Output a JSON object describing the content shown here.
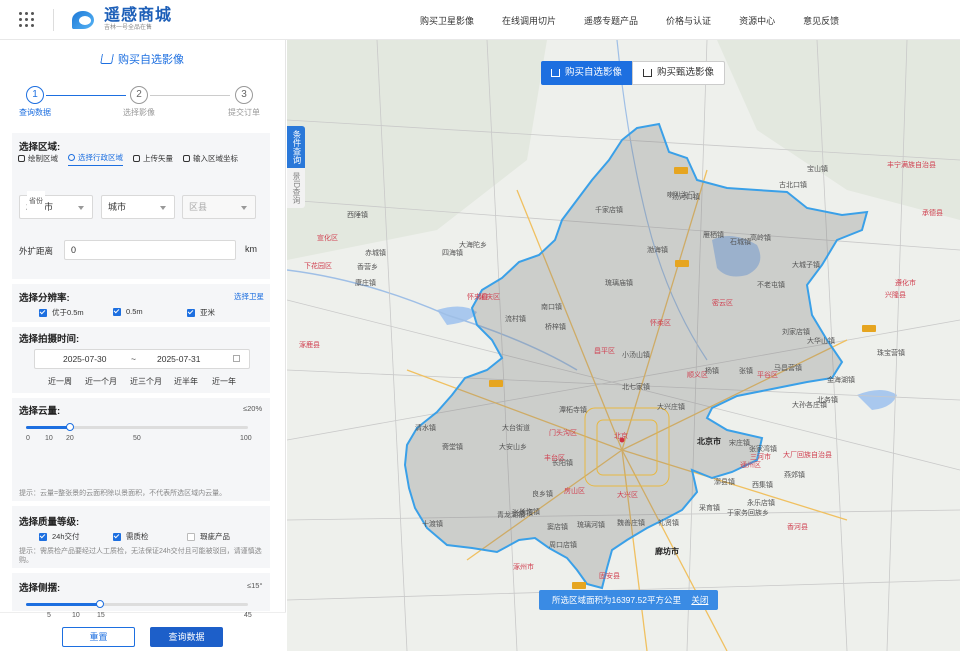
{
  "header": {
    "logo_title": "遥感商城",
    "logo_subtitle": "吉林一号全品在售",
    "nav": [
      "购买卫星影像",
      "在线调用切片",
      "遥感专题产品",
      "价格与认证",
      "资源中心",
      "意见反馈"
    ]
  },
  "sidebar": {
    "title": "购买自选影像",
    "steps": [
      {
        "num": "1",
        "label": "查询数据"
      },
      {
        "num": "2",
        "label": "选择影像"
      },
      {
        "num": "3",
        "label": "提交订单"
      }
    ],
    "region": {
      "title": "选择区域:",
      "tabs": [
        "绘制区域",
        "选择行政区域",
        "上传矢量",
        "输入区域坐标"
      ],
      "province_legend": "省份",
      "province": "北京市",
      "city": "城市",
      "district": "区县",
      "buffer_label": "外扩距离",
      "buffer_value": "0",
      "buffer_unit": "km"
    },
    "resolution": {
      "title": "选择分辨率:",
      "link": "选择卫星",
      "options": [
        {
          "label": "优于0.5m",
          "checked": true
        },
        {
          "label": "0.5m",
          "checked": true
        },
        {
          "label": "亚米",
          "checked": true
        }
      ]
    },
    "time": {
      "title": "选择拍摄时间:",
      "start": "2025-07-30",
      "sep": "~",
      "end": "2025-07-31",
      "quick": [
        "近一周",
        "近一个月",
        "近三个月",
        "近半年",
        "近一年"
      ]
    },
    "cloud": {
      "title": "选择云量:",
      "value_label": "≤20%",
      "value": 20,
      "max": 100,
      "ticks": [
        "0",
        "10",
        "20",
        "50",
        "100"
      ],
      "hint": "提示：云量=整张景的云面积除以景面积，不代表所选区域内云量。"
    },
    "quality": {
      "title": "选择质量等级:",
      "options": [
        {
          "label": "24h交付",
          "checked": true
        },
        {
          "label": "需质检",
          "checked": true
        },
        {
          "label": "瑕疵产品",
          "checked": false
        }
      ],
      "hint": "提示：需质检产品要经过人工质检，无法保证24h交付且可能被驳回，请谨慎选购。"
    },
    "tilt": {
      "title": "选择侧摆:",
      "value_label": "≤15°",
      "value": 15,
      "max": 45,
      "ticks": [
        "0",
        "5",
        "10",
        "15",
        "45"
      ]
    },
    "buttons": {
      "reset": "重置",
      "query": "查询数据"
    }
  },
  "map": {
    "side_tab_primary": "条件查询",
    "side_tab_secondary": "景ID查询",
    "toggle_active": "购买自选影像",
    "toggle_inactive": "购买甄选影像",
    "area_text": "所选区域面积为16397.52平方公里",
    "area_close": "关闭",
    "labels": [
      {
        "t": "北京",
        "c": "dist"
      },
      {
        "t": "北京市",
        "c": "big"
      },
      {
        "t": "廊坊市",
        "c": "big"
      },
      {
        "t": "门头沟区",
        "c": "dist"
      },
      {
        "t": "丰台区",
        "c": "dist"
      },
      {
        "t": "房山区",
        "c": "dist"
      },
      {
        "t": "大兴区",
        "c": "dist"
      },
      {
        "t": "昌平区",
        "c": "dist"
      },
      {
        "t": "怀柔区",
        "c": "dist"
      },
      {
        "t": "密云区",
        "c": "dist"
      },
      {
        "t": "顺义区",
        "c": "dist"
      },
      {
        "t": "平谷区",
        "c": "dist"
      },
      {
        "t": "延庆区",
        "c": "dist"
      },
      {
        "t": "通州区",
        "c": "dist"
      },
      {
        "t": "三河市",
        "c": "dist"
      },
      {
        "t": "涿州市",
        "c": "dist"
      },
      {
        "t": "固安县",
        "c": "dist"
      },
      {
        "t": "兴隆县",
        "c": "dist"
      },
      {
        "t": "怀来县",
        "c": "dist"
      },
      {
        "t": "涿鹿县",
        "c": "dist"
      },
      {
        "t": "丰宁满族自治县",
        "c": "dist"
      },
      {
        "t": "大厂回族自治县",
        "c": "dist"
      },
      {
        "t": "香河县",
        "c": "dist"
      },
      {
        "t": "宣化区",
        "c": "dist"
      },
      {
        "t": "下花园区",
        "c": "dist"
      },
      {
        "t": "承德县",
        "c": "dist"
      },
      {
        "t": "遵化市",
        "c": "dist"
      },
      {
        "t": "汤河口镇",
        "c": ""
      },
      {
        "t": "雁栖镇",
        "c": ""
      },
      {
        "t": "石城镇",
        "c": ""
      },
      {
        "t": "高岭镇",
        "c": ""
      },
      {
        "t": "杨镇",
        "c": ""
      },
      {
        "t": "张镇",
        "c": ""
      },
      {
        "t": "马昌营镇",
        "c": ""
      },
      {
        "t": "清水镇",
        "c": ""
      },
      {
        "t": "大安山乡",
        "c": ""
      },
      {
        "t": "十渡镇",
        "c": ""
      },
      {
        "t": "张坊镇",
        "c": ""
      },
      {
        "t": "良乡镇",
        "c": ""
      },
      {
        "t": "长沟镇",
        "c": ""
      },
      {
        "t": "窦店镇",
        "c": ""
      },
      {
        "t": "礼贤镇",
        "c": ""
      },
      {
        "t": "永乐店镇",
        "c": ""
      },
      {
        "t": "漷县镇",
        "c": ""
      },
      {
        "t": "西集镇",
        "c": ""
      },
      {
        "t": "宋庄镇",
        "c": ""
      },
      {
        "t": "南口镇",
        "c": ""
      },
      {
        "t": "流村镇",
        "c": ""
      },
      {
        "t": "小汤山镇",
        "c": ""
      },
      {
        "t": "北七家镇",
        "c": ""
      },
      {
        "t": "大兴庄镇",
        "c": ""
      },
      {
        "t": "香营乡",
        "c": ""
      },
      {
        "t": "四海镇",
        "c": ""
      },
      {
        "t": "康庄镇",
        "c": ""
      },
      {
        "t": "千家店镇",
        "c": ""
      },
      {
        "t": "喇叭沟门",
        "c": ""
      },
      {
        "t": "宝山镇",
        "c": ""
      },
      {
        "t": "琉璃庙镇",
        "c": ""
      },
      {
        "t": "渤海镇",
        "c": ""
      },
      {
        "t": "桥梓镇",
        "c": ""
      },
      {
        "t": "大城子镇",
        "c": ""
      },
      {
        "t": "不老屯镇",
        "c": ""
      },
      {
        "t": "古北口镇",
        "c": ""
      },
      {
        "t": "刘家店镇",
        "c": ""
      },
      {
        "t": "大华山镇",
        "c": ""
      },
      {
        "t": "金海湖镇",
        "c": ""
      },
      {
        "t": "斋堂镇",
        "c": ""
      },
      {
        "t": "潭柘寺镇",
        "c": ""
      },
      {
        "t": "大台街道",
        "c": ""
      },
      {
        "t": "青龙湖镇",
        "c": ""
      },
      {
        "t": "周口店镇",
        "c": ""
      },
      {
        "t": "琉璃河镇",
        "c": ""
      },
      {
        "t": "长阳镇",
        "c": ""
      },
      {
        "t": "魏善庄镇",
        "c": ""
      },
      {
        "t": "采育镇",
        "c": ""
      },
      {
        "t": "于家务回族乡",
        "c": ""
      },
      {
        "t": "张家湾镇",
        "c": ""
      },
      {
        "t": "燕郊镇",
        "c": ""
      },
      {
        "t": "大孙各庄镇",
        "c": ""
      },
      {
        "t": "北务镇",
        "c": ""
      },
      {
        "t": "珠宝营镇",
        "c": ""
      },
      {
        "t": "西陲镇",
        "c": ""
      },
      {
        "t": "赤城镇",
        "c": ""
      },
      {
        "t": "大海陀乡",
        "c": ""
      }
    ]
  }
}
